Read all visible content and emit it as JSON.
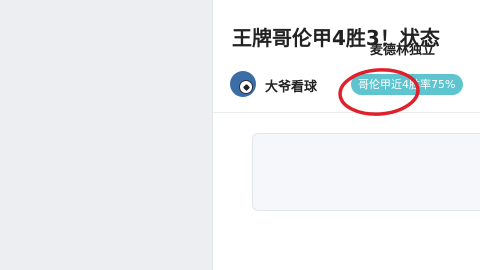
{
  "article": {
    "title": "王牌哥伦甲4胜3！状态",
    "author": {
      "name": "大爷看球",
      "avatar_icon": "soccer-ball-icon"
    },
    "tag": "哥伦甲近4胜率75%",
    "quote_text": "麦德林独立"
  },
  "colors": {
    "tag_bg": "#5ec4cf",
    "annotation": "#e0202a",
    "orange_badge": "#f3a83a"
  }
}
